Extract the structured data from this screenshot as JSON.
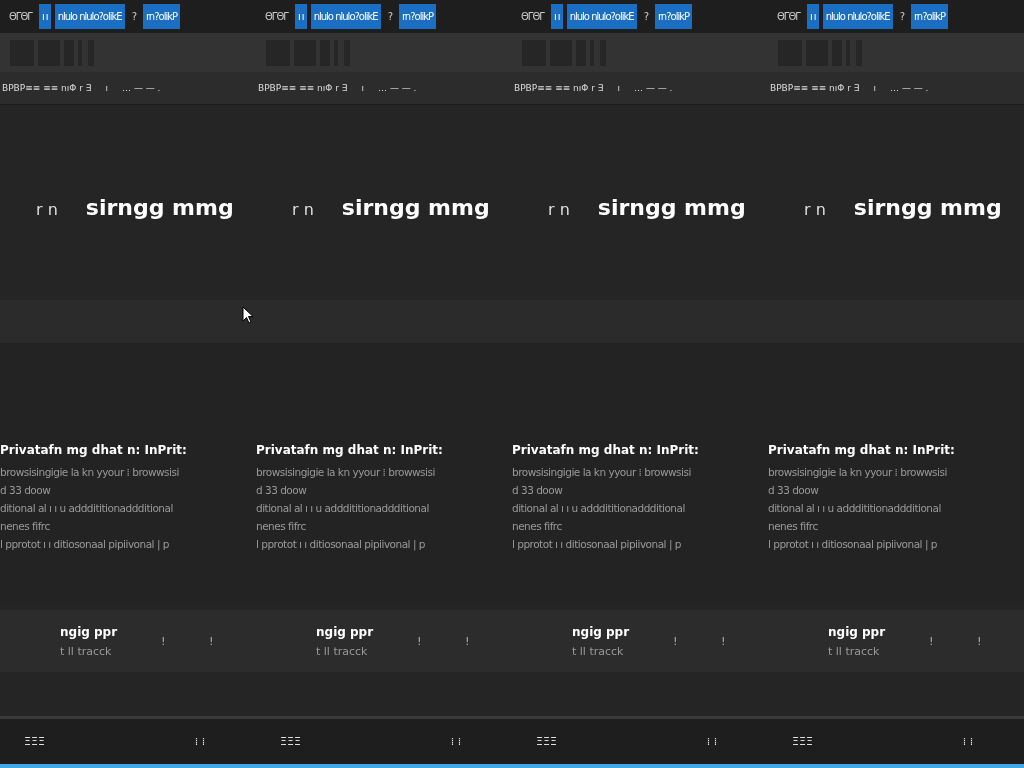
{
  "tiles": [
    {
      "tabs": [
        {
          "label": "ΘΓΘΓ",
          "selected": false
        },
        {
          "label": "ı ı",
          "selected": true
        },
        {
          "label": "nlulo nlulo?olikE",
          "selected": true
        },
        {
          "label": "?",
          "selected": false
        },
        {
          "label": "rn?olikP",
          "selected": true
        }
      ],
      "bookmarks": [
        "ΒΡΒΡ≡≡ ≡≡ nıΦ r ∃",
        "ı",
        "… — — ."
      ],
      "heading": {
        "prefix": "r n",
        "title": "sirngg mmg"
      },
      "info": {
        "title": "Privatafn mg dhat n: InPrit:",
        "lines": [
          "browsisingigie la kn yyour ⁞ browwsisi",
          "d 33   doow",
          "ditional al  ı ı  u adddititionaddditional",
          "nenes fifrc",
          "l pprotot  ı ı   ditiosonaal pipiivonal | p"
        ]
      },
      "card": {
        "title": "ngig ppr",
        "subtitle": "t ll tracck",
        "marks": [
          "!",
          "!"
        ]
      },
      "status": [
        "ΞΞΞ",
        "⁞ ⁞"
      ]
    },
    {
      "tabs": [
        {
          "label": "ΘΓΘΓ",
          "selected": false
        },
        {
          "label": "ı ı",
          "selected": true
        },
        {
          "label": "nlulo nlulo?olikE",
          "selected": true
        },
        {
          "label": "?",
          "selected": false
        },
        {
          "label": "rn?olikP",
          "selected": true
        }
      ],
      "bookmarks": [
        "ΒΡΒΡ≡≡ ≡≡ nıΦ r ∃",
        "ı",
        "… — — ."
      ],
      "heading": {
        "prefix": "r n",
        "title": "sirngg mmg"
      },
      "info": {
        "title": "Privatafn mg dhat n: InPrit:",
        "lines": [
          "browsisingigie la kn yyour ⁞ browwsisi",
          "d 33   doow",
          "ditional al  ı ı  u adddititionaddditional",
          "nenes fifrc",
          "l pprotot  ı ı   ditiosonaal pipiivonal | p"
        ]
      },
      "card": {
        "title": "ngig ppr",
        "subtitle": "t ll tracck",
        "marks": [
          "!",
          "!"
        ]
      },
      "status": [
        "ΞΞΞ",
        "⁞ ⁞"
      ]
    },
    {
      "tabs": [
        {
          "label": "ΘΓΘΓ",
          "selected": false
        },
        {
          "label": "ı ı",
          "selected": true
        },
        {
          "label": "nlulo nlulo?olikE",
          "selected": true
        },
        {
          "label": "?",
          "selected": false
        },
        {
          "label": "rn?olikP",
          "selected": true
        }
      ],
      "bookmarks": [
        "ΒΡΒΡ≡≡ ≡≡ nıΦ r ∃",
        "ı",
        "… — — ."
      ],
      "heading": {
        "prefix": "r n",
        "title": "sirngg mmg"
      },
      "info": {
        "title": "Privatafn mg dhat n: InPrit:",
        "lines": [
          "browsisingigie la kn yyour ⁞ browwsisi",
          "d 33   doow",
          "ditional al  ı ı  u adddititionaddditional",
          "nenes fifrc",
          "l pprotot  ı ı   ditiosonaal pipiivonal | p"
        ]
      },
      "card": {
        "title": "ngig ppr",
        "subtitle": "t ll tracck",
        "marks": [
          "!",
          "!"
        ]
      },
      "status": [
        "ΞΞΞ",
        "⁞ ⁞"
      ]
    },
    {
      "tabs": [
        {
          "label": "ΘΓΘΓ",
          "selected": false
        },
        {
          "label": "ı ı",
          "selected": true
        },
        {
          "label": "nlulo nlulo?olikE",
          "selected": true
        },
        {
          "label": "?",
          "selected": false
        },
        {
          "label": "rn?olikP",
          "selected": true
        }
      ],
      "bookmarks": [
        "ΒΡΒΡ≡≡ ≡≡ nıΦ r ∃",
        "ı",
        "… — — ."
      ],
      "heading": {
        "prefix": "r n",
        "title": "sirngg mmg"
      },
      "info": {
        "title": "Privatafn mg dhat n: InPrit:",
        "lines": [
          "browsisingigie la kn yyour ⁞ browwsisi",
          "d 33   doow",
          "ditional al  ı ı  u adddititionaddditional",
          "nenes fifrc",
          "l pprotot  ı ı   ditiosonaal pipiivonal | p"
        ]
      },
      "card": {
        "title": "ngig ppr",
        "subtitle": "t ll tracck",
        "marks": [
          "!",
          "!"
        ]
      },
      "status": [
        "ΞΞΞ",
        "⁞ ⁞"
      ]
    }
  ]
}
